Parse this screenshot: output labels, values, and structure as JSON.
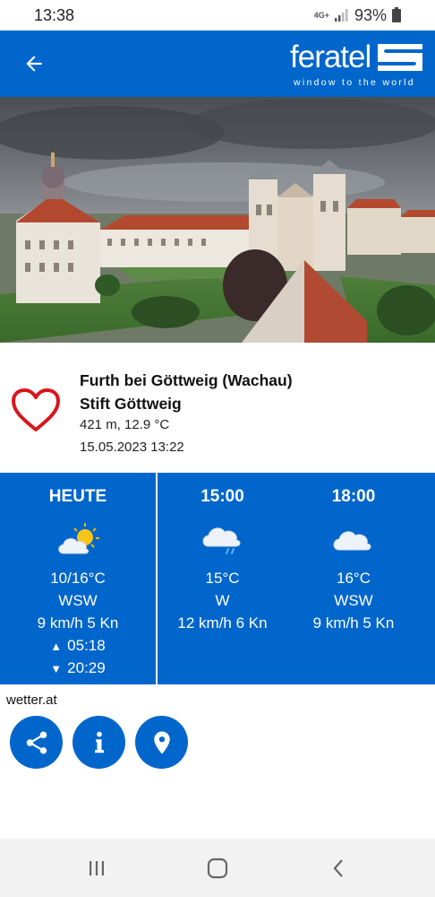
{
  "status_bar": {
    "time": "13:38",
    "network_type": "4G+",
    "battery": "93%"
  },
  "app_bar": {
    "logo_text": "feratel",
    "logo_tagline": "window to the world"
  },
  "webcam": {
    "alt": "Stift Göttweig webcam image"
  },
  "location": {
    "name": "Furth bei Göttweig (Wachau)",
    "camera": "Stift Göttweig",
    "altitude_temp": "421 m, 12.9 °C",
    "timestamp": "15.05.2023 13:22"
  },
  "forecast": [
    {
      "label": "HEUTE",
      "icon": "sun-cloud-icon",
      "temp": "10/16°C",
      "wind_dir": "WSW",
      "wind_speed": "9 km/h 5 Kn",
      "sunrise": "05:18",
      "sunset": "20:29"
    },
    {
      "label": "15:00",
      "icon": "cloud-rain-icon",
      "temp": "15°C",
      "wind_dir": "W",
      "wind_speed": "12 km/h 6 Kn"
    },
    {
      "label": "18:00",
      "icon": "cloud-icon",
      "temp": "16°C",
      "wind_dir": "WSW",
      "wind_speed": "9 km/h 5 Kn"
    }
  ],
  "source": "wetter.at",
  "actions": [
    "share-icon",
    "info-icon",
    "location-pin-icon"
  ],
  "colors": {
    "brand_blue": "#0066cc",
    "heart_red": "#d9161b"
  }
}
